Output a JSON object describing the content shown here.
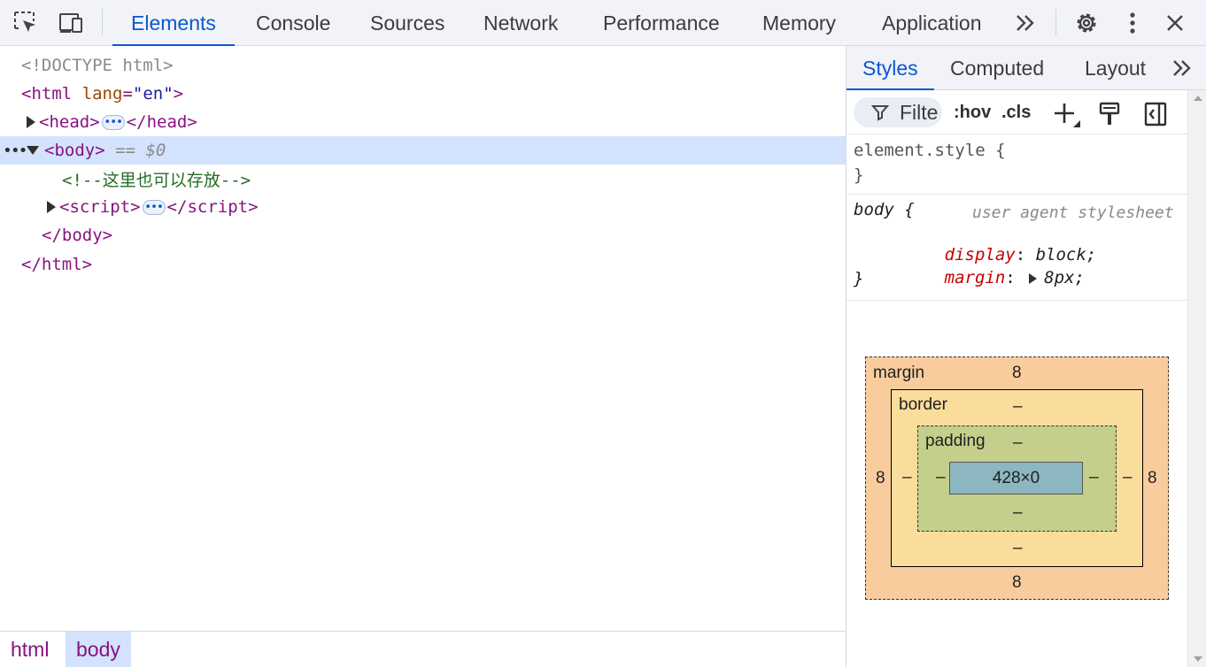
{
  "toolbar": {
    "tabs": [
      "Elements",
      "Console",
      "Sources",
      "Network",
      "Performance",
      "Memory",
      "Application"
    ],
    "active_tab": "Elements",
    "more_tabs_icon": "chevron-double-right-icon",
    "inspect_icon": "inspect-element-icon",
    "device_icon": "device-toolbar-icon",
    "settings_icon": "gear-icon",
    "menu_icon": "kebab-menu-icon",
    "close_icon": "close-icon"
  },
  "dom": {
    "doctype": "<!DOCTYPE html>",
    "html_open_tag": "html",
    "html_attr": "lang",
    "html_attr_val": "\"en\"",
    "head_tag": "head",
    "body_tag": "body",
    "selected_marker": "== $0",
    "comment": "<!--这里也可以存放-->",
    "script_tag": "script",
    "body_close": "</body>",
    "html_close": "</html>",
    "ellipsis": "•••"
  },
  "breadcrumbs": [
    "html",
    "body"
  ],
  "sidebar": {
    "tabs": [
      "Styles",
      "Computed",
      "Layout"
    ],
    "active_tab": "Styles",
    "filter_placeholder": "Filte",
    "hov_label": ":hov",
    "cls_label": ".cls",
    "element_style_selector": "element.style {",
    "close_brace": "}",
    "body_selector": "body {",
    "ua_label": "user agent stylesheet",
    "props": [
      {
        "name": "display",
        "value": "block;"
      },
      {
        "name": "margin",
        "value": "8px;"
      }
    ]
  },
  "box_model": {
    "margin_label": "margin",
    "border_label": "border",
    "padding_label": "padding",
    "margin_top": "8",
    "margin_bottom": "8",
    "margin_left": "8",
    "margin_right": "8",
    "border_top": "–",
    "border_bottom": "–",
    "border_left": "–",
    "border_right": "–",
    "padding_top": "–",
    "padding_bottom": "–",
    "padding_left": "–",
    "padding_right": "–",
    "content": "428×0"
  },
  "colors": {
    "accent": "#0b57d0",
    "selection": "#d3e3fd",
    "tag": "#881280",
    "comment": "#236e25",
    "margin_box": "#f9cc9d",
    "border_box": "#fbdd9b",
    "padding_box": "#c3cf8a",
    "content_box": "#8cb6c0"
  }
}
